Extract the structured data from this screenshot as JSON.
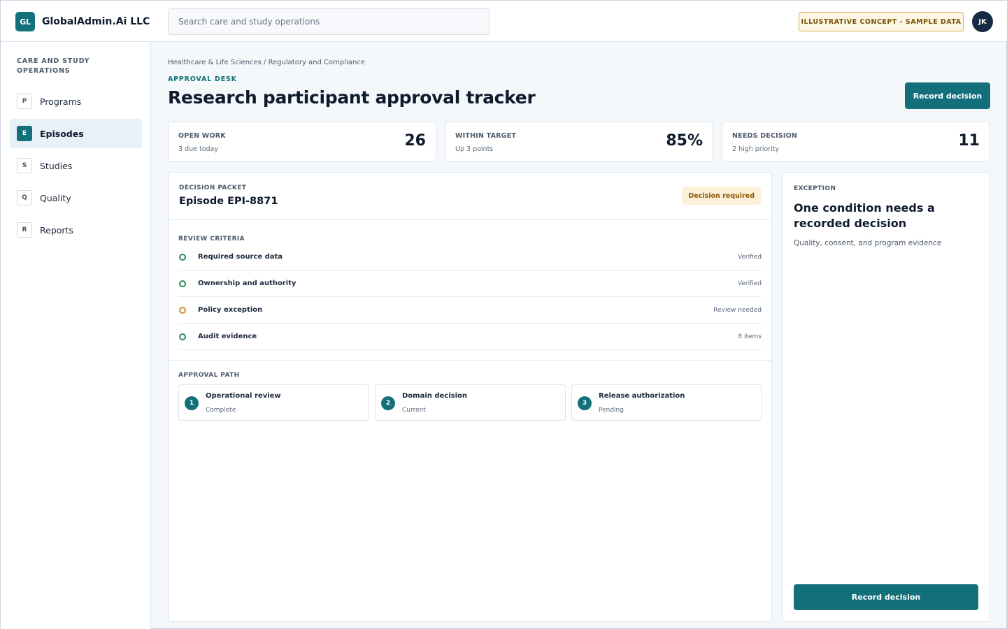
{
  "brand": {
    "logo": "GL",
    "name": "GlobalAdmin.Ai LLC"
  },
  "search": {
    "placeholder": "Search care and study operations"
  },
  "topbar": {
    "badge": "ILLUSTRATIVE CONCEPT - SAMPLE DATA",
    "avatar": "JK"
  },
  "sidebar": {
    "title": "CARE AND STUDY OPERATIONS",
    "items": [
      {
        "key": "P",
        "label": "Programs",
        "active": false
      },
      {
        "key": "E",
        "label": "Episodes",
        "active": true
      },
      {
        "key": "S",
        "label": "Studies",
        "active": false
      },
      {
        "key": "Q",
        "label": "Quality",
        "active": false
      },
      {
        "key": "R",
        "label": "Reports",
        "active": false
      }
    ]
  },
  "page": {
    "breadcrumb": "Healthcare & Life Sciences / Regulatory and Compliance",
    "eyebrow": "APPROVAL DESK",
    "title": "Research participant approval tracker",
    "action_label": "Record decision"
  },
  "metrics": [
    {
      "label": "OPEN WORK",
      "sub": "3 due today",
      "value": "26"
    },
    {
      "label": "WITHIN TARGET",
      "sub": "Up 3 points",
      "value": "85%"
    },
    {
      "label": "NEEDS DECISION",
      "sub": "2 high priority",
      "value": "11"
    }
  ],
  "packet": {
    "label": "DECISION PACKET",
    "title": "Episode EPI-8871",
    "badge": "Decision required",
    "criteria_label": "REVIEW CRITERIA",
    "criteria": [
      {
        "name": "Required source data",
        "status": "Verified",
        "state": "ok"
      },
      {
        "name": "Ownership and authority",
        "status": "Verified",
        "state": "ok"
      },
      {
        "name": "Policy exception",
        "status": "Review needed",
        "state": "warn"
      },
      {
        "name": "Audit evidence",
        "status": "8 items",
        "state": "ok"
      }
    ],
    "path_label": "APPROVAL PATH",
    "steps": [
      {
        "num": "1",
        "title": "Operational review",
        "status": "Complete"
      },
      {
        "num": "2",
        "title": "Domain decision",
        "status": "Current"
      },
      {
        "num": "3",
        "title": "Release authorization",
        "status": "Pending"
      }
    ]
  },
  "exception": {
    "label": "EXCEPTION",
    "title": "One condition needs a recorded decision",
    "desc": "Quality, consent, and program evidence",
    "action_label": "Record decision"
  },
  "colors": {
    "accent": "#13707a",
    "ok": "#2f8a5a",
    "warn": "#d18a26",
    "navy": "#162b45"
  }
}
